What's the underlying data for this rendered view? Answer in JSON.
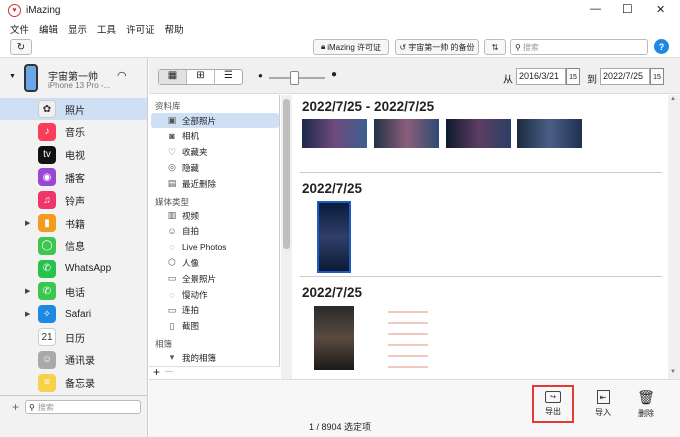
{
  "window": {
    "title": "iMazing",
    "minimize": "—",
    "maximize": "☐",
    "close": "✕"
  },
  "menu": [
    "文件",
    "编辑",
    "显示",
    "工具",
    "许可证",
    "帮助"
  ],
  "toolbar": {
    "license": "iMazing 许可证",
    "backup": "宇宙第一帅 的备份",
    "search_placeholder": "搜索",
    "help": "?"
  },
  "device": {
    "name": "宇宙第一帅",
    "model": "iPhone 13 Pro -..."
  },
  "sidebar": {
    "items": [
      {
        "label": "照片",
        "color": "#f0f0f0",
        "glyph": "✿",
        "selected": true,
        "expand": false
      },
      {
        "label": "音乐",
        "color": "#fa3e5a",
        "glyph": "♪",
        "expand": false
      },
      {
        "label": "电视",
        "color": "#111111",
        "glyph": "tv",
        "expand": false
      },
      {
        "label": "播客",
        "color": "#9b47d6",
        "glyph": "◉",
        "expand": false
      },
      {
        "label": "铃声",
        "color": "#f0356b",
        "glyph": "♫",
        "expand": false
      },
      {
        "label": "书籍",
        "color": "#f39b1e",
        "glyph": "▮",
        "expand": true
      },
      {
        "label": "信息",
        "color": "#3ac64f",
        "glyph": "◯",
        "expand": false
      },
      {
        "label": "WhatsApp",
        "color": "#27c24c",
        "glyph": "✆",
        "expand": false
      },
      {
        "label": "电话",
        "color": "#3ac64f",
        "glyph": "✆",
        "expand": true
      },
      {
        "label": "Safari",
        "color": "#1e88e5",
        "glyph": "✧",
        "expand": true
      },
      {
        "label": "日历",
        "color": "#ffffff",
        "glyph": "21",
        "expand": false
      },
      {
        "label": "通讯录",
        "color": "#a9a9a9",
        "glyph": "☺",
        "expand": false
      },
      {
        "label": "备忘录",
        "color": "#f7d248",
        "glyph": "≡",
        "expand": false
      }
    ],
    "search_placeholder": "搜索",
    "add": "+"
  },
  "viewbar": {
    "from_label": "从",
    "from_date": "2016/3/21",
    "to_label": "到",
    "to_date": "2022/7/25",
    "cal": "15"
  },
  "library": {
    "headers": [
      "资料库",
      "媒体类型",
      "相簿"
    ],
    "items": [
      "全部照片",
      "相机",
      "收藏夹",
      "隐藏",
      "最近删除"
    ],
    "media": [
      "视频",
      "自拍",
      "Live Photos",
      "人像",
      "全景照片",
      "慢动作",
      "连拍",
      "截图"
    ],
    "albums": [
      "我的相簿"
    ],
    "add": "+",
    "minus": "—"
  },
  "sections": [
    {
      "title": "2022/7/25 - 2022/7/25"
    },
    {
      "title": "2022/7/25"
    },
    {
      "title": "2022/7/25"
    }
  ],
  "actions": {
    "export": "导出",
    "import": "导入",
    "delete": "删除"
  },
  "status": "1 / 8904 选定项",
  "colors": {
    "selected_row": "#cfe0f5",
    "highlight_box": "#e53935",
    "accent": "#1e88e5"
  }
}
